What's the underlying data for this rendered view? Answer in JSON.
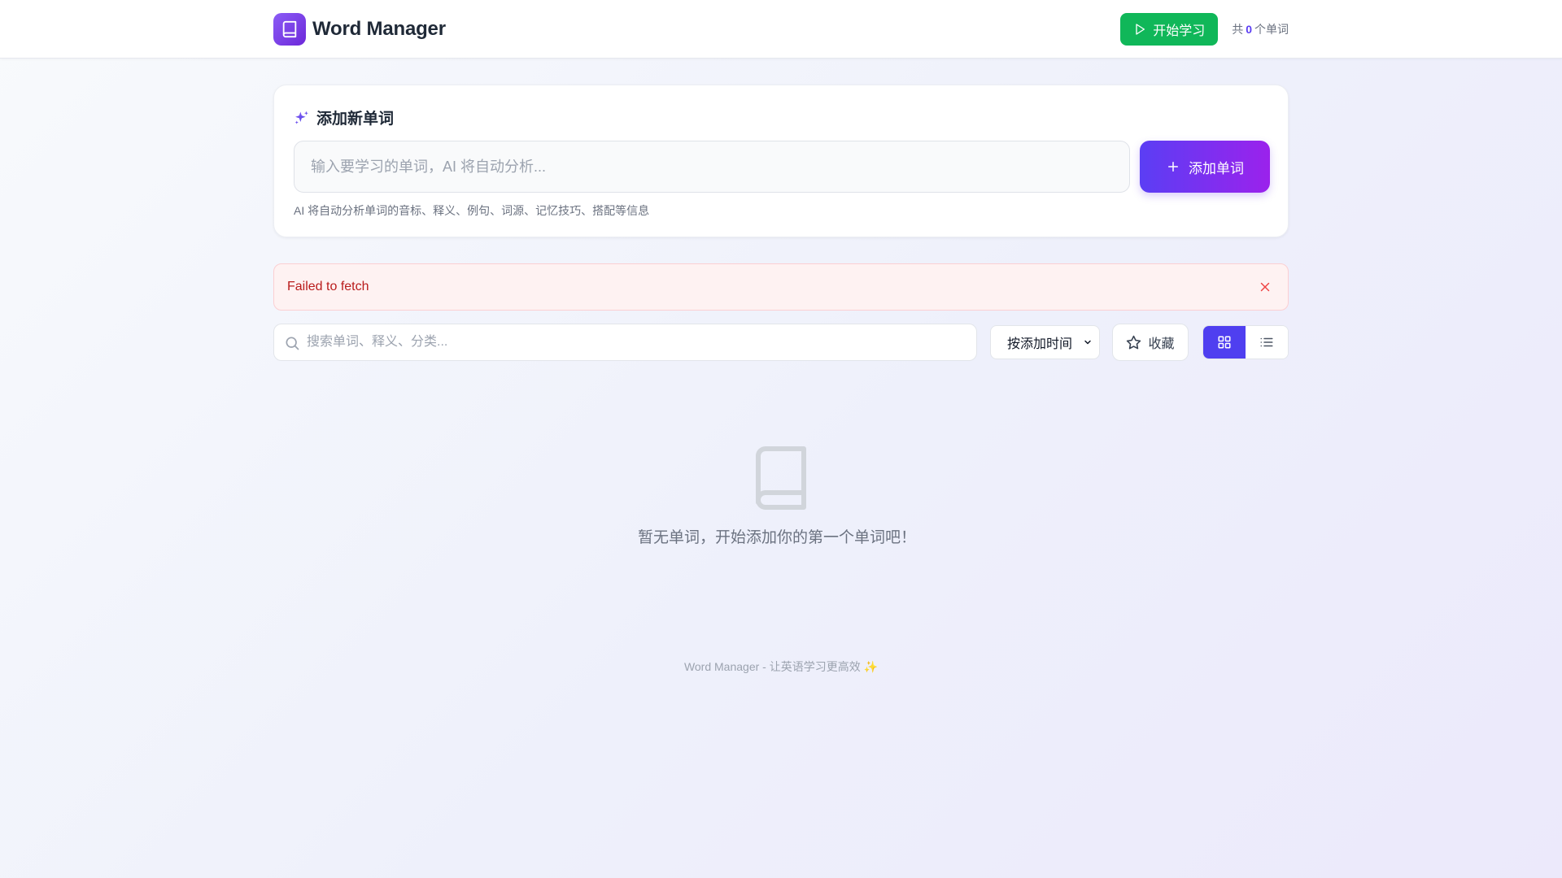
{
  "header": {
    "brand_title": "Word Manager",
    "start_button_label": "开始学习",
    "count_prefix": "共",
    "count_value": "0",
    "count_suffix": "个单词"
  },
  "add_card": {
    "title": "添加新单词",
    "input_placeholder": "输入要学习的单词，AI 将自动分析...",
    "input_value": "",
    "add_button_label": "添加单词",
    "hint": "AI 将自动分析单词的音标、释义、例句、词源、记忆技巧、搭配等信息"
  },
  "error": {
    "message": "Failed to fetch"
  },
  "toolbar": {
    "search_placeholder": "搜索单词、释义、分类...",
    "search_value": "",
    "sort_selected": "按添加时间",
    "favorites_label": "收藏",
    "view_mode": "grid"
  },
  "empty_state": {
    "message": "暂无单词，开始添加你的第一个单词吧！"
  },
  "footer": {
    "text": "Word Manager - 让英语学习更高效 ✨"
  },
  "icons": {
    "logo": "book-icon",
    "start": "play-icon",
    "title": "sparkles-icon",
    "add": "plus-icon",
    "close": "close-icon",
    "search": "search-icon",
    "sort": "chevron-down-icon",
    "favorites": "star-icon",
    "grid": "grid-icon",
    "list": "list-icon",
    "empty": "book-icon"
  },
  "colors": {
    "brand_purple": "#7c3aed",
    "start_green": "#10b759",
    "add_gradient_start": "#5b3ef4",
    "add_gradient_end": "#9b22ec",
    "count_accent": "#5b3ef2",
    "error_red": "#b91c1c",
    "error_bg": "#fef2f2",
    "view_active": "#4f3ff0"
  }
}
